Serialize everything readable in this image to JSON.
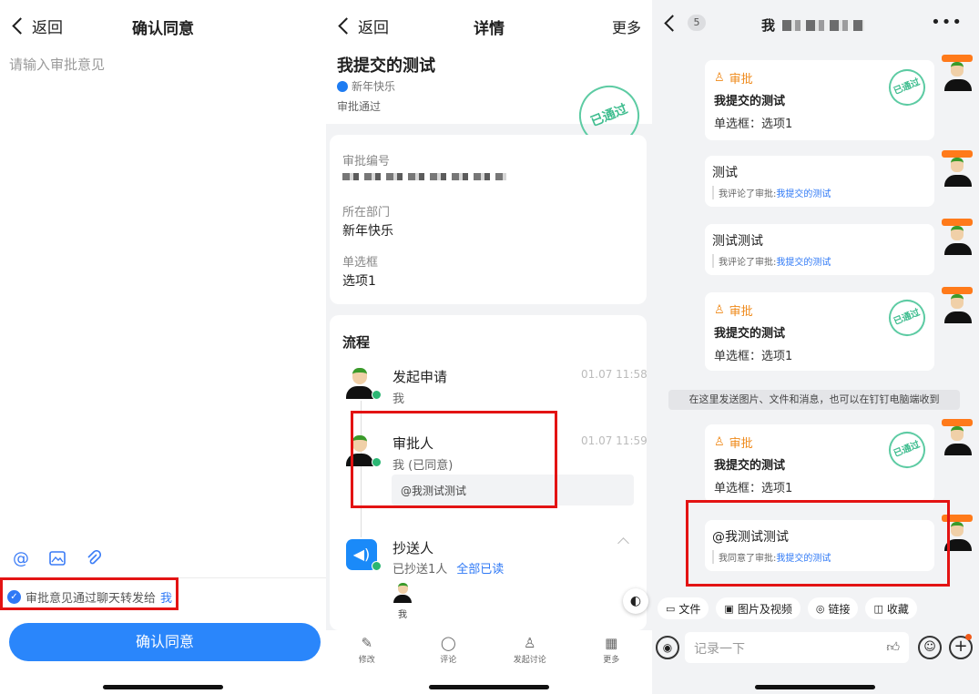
{
  "confirm_screen": {
    "back_label": "返回",
    "title": "确认同意",
    "placeholder": "请输入审批意见",
    "tool_icons": [
      "at-icon",
      "image-icon",
      "attachment-icon"
    ],
    "forward_text": "审批意见通过聊天转发给",
    "forward_target": "我",
    "confirm_button": "确认同意"
  },
  "detail_screen": {
    "back_label": "返回",
    "title": "详情",
    "more_label": "更多",
    "approval_title": "我提交的测试",
    "org": "新年快乐",
    "status": "审批通过",
    "stamp_text": "已通过",
    "fields": [
      {
        "label": "审批编号",
        "value": ""
      },
      {
        "label": "所在部门",
        "value": "新年快乐"
      },
      {
        "label": "单选框",
        "value": "选项1"
      }
    ],
    "process_title": "流程",
    "steps": {
      "initiate": {
        "name": "发起申请",
        "sub": "我",
        "time": "01.07 11:58"
      },
      "approver": {
        "name": "审批人",
        "sub": "我 (已同意)",
        "time": "01.07 11:59",
        "comment": "@我测试测试"
      },
      "cc": {
        "name": "抄送人",
        "sub": "已抄送1人",
        "read_status": "全部已读",
        "member": "我"
      }
    },
    "bottom_nav": [
      {
        "label": "修改",
        "icon": "edit-icon"
      },
      {
        "label": "评论",
        "icon": "comment-icon"
      },
      {
        "label": "发起讨论",
        "icon": "discussion-icon"
      },
      {
        "label": "更多",
        "icon": "grid-icon"
      }
    ]
  },
  "chat_screen": {
    "unread_count": "5",
    "title": "我",
    "messages": {
      "m1": {
        "tag": "审批",
        "title": "我提交的测试",
        "line": "单选框：选项1",
        "stamp": "已通过"
      },
      "m2": {
        "text": "测试",
        "quote_prefix": "我评论了审批:",
        "quote_link": "我提交的测试"
      },
      "m3": {
        "text": "测试测试",
        "quote_prefix": "我评论了审批:",
        "quote_link": "我提交的测试"
      },
      "m4": {
        "tag": "审批",
        "title": "我提交的测试",
        "line": "单选框：选项1",
        "stamp": "已通过"
      },
      "m5": {
        "tag": "审批",
        "title": "我提交的测试",
        "line": "单选框：选项1",
        "stamp": "已通过"
      },
      "m6": {
        "text": "@我测试测试",
        "quote_prefix": "我同意了审批:",
        "quote_link": "我提交的测试"
      }
    },
    "system_note": "在这里发送图片、文件和消息，也可以在钉钉电脑端收到",
    "quick_chips": [
      {
        "label": "文件",
        "icon": "folder-icon"
      },
      {
        "label": "图片及视频",
        "icon": "picture-icon"
      },
      {
        "label": "链接",
        "icon": "link-icon"
      },
      {
        "label": "收藏",
        "icon": "bookmark-icon"
      }
    ],
    "input_placeholder": "记录一下"
  },
  "colors": {
    "accent_blue": "#2a86fb",
    "highlight_red": "#e31313",
    "approval_orange": "#ef8a1b",
    "stamp_green": "#3fbd8f"
  }
}
